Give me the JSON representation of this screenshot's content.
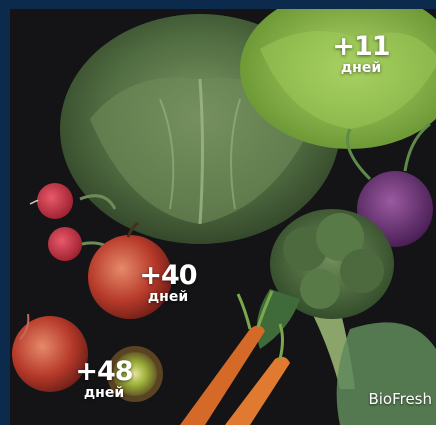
{
  "badges": [
    {
      "value": "+11",
      "unit": "дней"
    },
    {
      "value": "+40",
      "unit": "дней"
    },
    {
      "value": "+48",
      "unit": "дней"
    }
  ],
  "brand_label": "BioFresh",
  "colors": {
    "frame": "#0c2a4c",
    "background": "#141416",
    "text": "#ffffff"
  }
}
